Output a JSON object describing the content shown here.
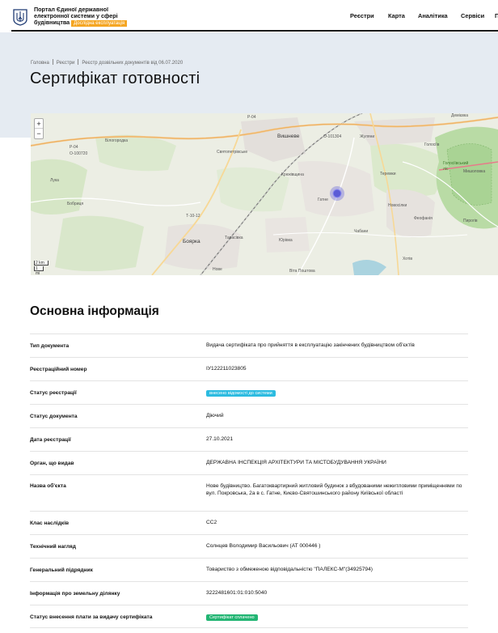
{
  "header": {
    "portal_line1": "Портал Єдиної державної",
    "portal_line2": "електронної системи у сфері",
    "portal_line3": "будівництва",
    "trial_badge": "Дослідна експлуатація",
    "nav": [
      "Реєстри",
      "Карта",
      "Аналітика",
      "Сервіси",
      "П"
    ]
  },
  "breadcrumb": {
    "home": "Головна",
    "registries": "Реєстри",
    "current": "Реєстр дозвільних документів від 06.07.2020"
  },
  "page_title": "Сертифікат готовності",
  "map": {
    "zoom_in": "+",
    "zoom_out": "−",
    "scale_km": "2 km",
    "scale_mi": "1 mi",
    "labels": [
      "Р-04",
      "Р-04",
      "О-100720",
      "Білогородка",
      "Святопетрівське",
      "Вишневе",
      "О-101304",
      "Жуляни",
      "Демієвка",
      "Голосіїв",
      "Голосіївський ліс",
      "Мишоловка",
      "Теремки",
      "Крюківщина",
      "Гатне",
      "Новосілки",
      "Лука",
      "Бобриця",
      "Т-10-12",
      "Боярка",
      "Тарасівка",
      "Юрівка",
      "Чабани",
      "Феофанія",
      "Пирогів",
      "Хотів",
      "Віта Поштова",
      "Нове"
    ],
    "marker_color": "#5b5bd6"
  },
  "section_title": "Основна інформація",
  "info": {
    "doc_type": {
      "label": "Тип документа",
      "value": "Видача сертифіката про прийняття в експлуатацію закінчених будівництвом об'єктів"
    },
    "reg_number": {
      "label": "Реєстраційний номер",
      "value": "ІУ122211023805"
    },
    "reg_status": {
      "label": "Статус реєстрації",
      "value": "внесено відомості до системи",
      "color": "#2cbbe0"
    },
    "doc_status": {
      "label": "Статус документа",
      "value": "Діючий"
    },
    "reg_date": {
      "label": "Дата реєстрації",
      "value": "27.10.2021"
    },
    "issuer": {
      "label": "Орган, що видав",
      "value": "ДЕРЖАВНА ІНСПЕКЦІЯ АРХІТЕКТУРИ ТА МІСТОБУДУВАННЯ УКРАЇНИ"
    },
    "object_name": {
      "label": "Назва об'єкта",
      "value": "Нове будівництво. Багатоквартирний житловий будинок з вбудованими нежитловими приміщеннями по вул. Покровська, 2а в с. Гатне, Києво-Святошинського району Київської області"
    },
    "class": {
      "label": "Клас наслідків",
      "value": "СС2"
    },
    "tech_supervision": {
      "label": "Технічний нагляд",
      "value": "Солнцев Володимир Васильович (АТ 000446 )"
    },
    "general_contractor": {
      "label": "Генеральний підрядник",
      "value": "Товариство з обмеженою відповідальністю \"ПАЛЕКС-М\"(34925794)"
    },
    "land_info": {
      "label": "Інформація про земельну ділянку",
      "value": "3222481601:01:010:5040"
    },
    "fee_status": {
      "label": "Статус внесення плати за видачу сертифіката",
      "value": "Сертифікат сплачено",
      "color": "#22b573"
    }
  }
}
